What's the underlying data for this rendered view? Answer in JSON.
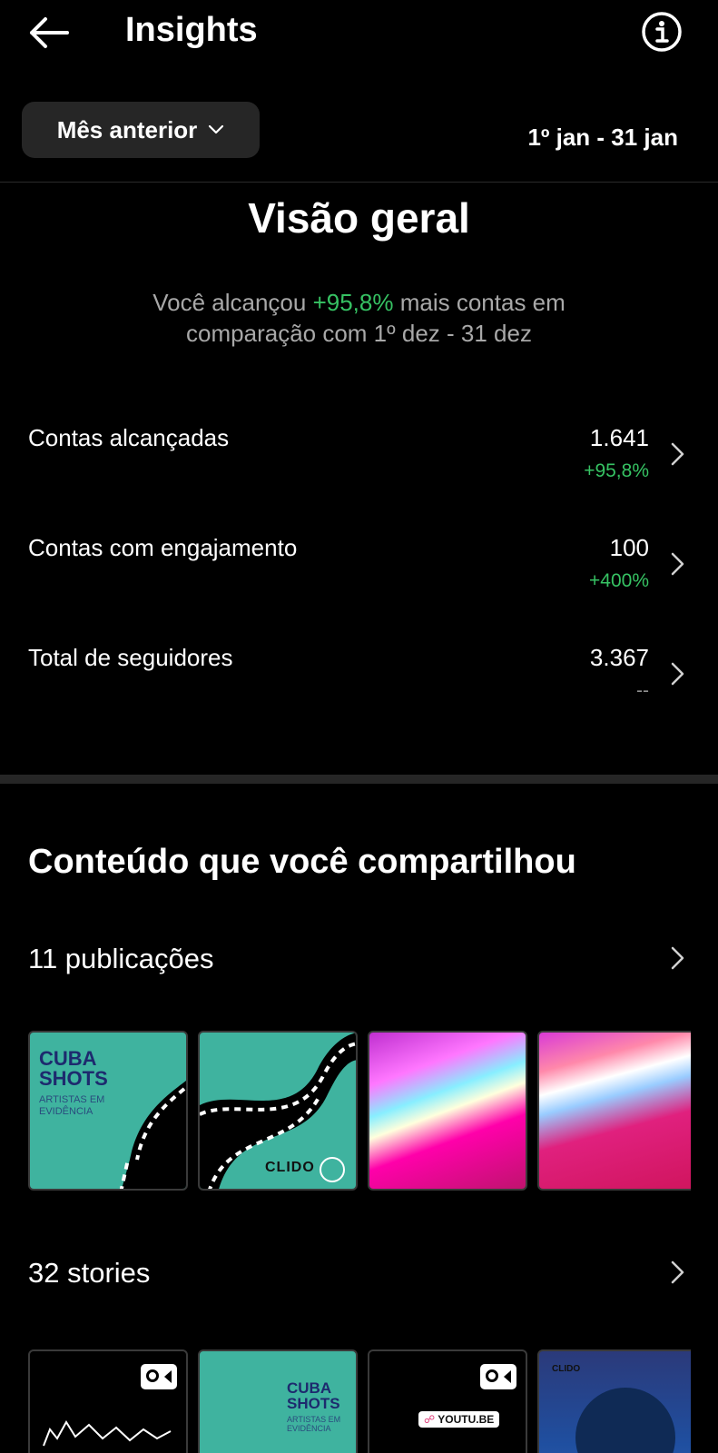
{
  "header": {
    "title": "Insights",
    "back_icon": "arrow-left-icon",
    "info_icon": "info-icon"
  },
  "filter": {
    "period_label": "Mês anterior",
    "date_range": "1º jan - 31 jan"
  },
  "overview": {
    "title": "Visão geral",
    "summary_prefix": "Você alcançou",
    "summary_highlight": "+95,8%",
    "summary_suffix": "mais contas em comparação com 1º dez - 31 dez",
    "metrics": [
      {
        "label": "Contas alcançadas",
        "value": "1.641",
        "delta": "+95,8%"
      },
      {
        "label": "Contas com engajamento",
        "value": "100",
        "delta": "+400%"
      },
      {
        "label": "Total de seguidores",
        "value": "3.367",
        "delta": "--"
      }
    ]
  },
  "content": {
    "title": "Conteúdo que você compartilhou",
    "posts_label": "11 publicações",
    "stories_label": "32 stories",
    "post_thumbs": [
      {
        "line1": "CUBA",
        "line2": "SHOTS",
        "sub1": "ARTISTAS EM",
        "sub2": "EVIDÊNCIA"
      },
      {
        "logo": "CLIDO"
      }
    ],
    "story_thumbs": [
      {
        "badge": "video-icon"
      },
      {
        "line1": "CUBA",
        "line2": "SHOTS",
        "sub1": "ARTISTAS EM",
        "sub2": "EVIDÊNCIA"
      },
      {
        "badge": "video-icon",
        "link": "YOUTU.BE"
      },
      {
        "logo": "CLIDO"
      }
    ]
  },
  "colors": {
    "background": "#000000",
    "positive": "#36c263",
    "muted": "#a8a8a8",
    "teal": "#3fb39f"
  }
}
